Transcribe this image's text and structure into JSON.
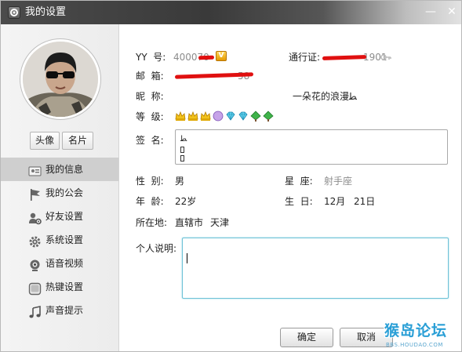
{
  "window": {
    "title": "我的设置",
    "minimize_glyph": "—",
    "close_glyph": "✕"
  },
  "sidebar": {
    "tab_avatar": "头像",
    "tab_card": "名片",
    "items": [
      {
        "label": "我的信息",
        "icon": "profile-card-icon",
        "active": true
      },
      {
        "label": "我的公会",
        "icon": "flag-icon",
        "active": false
      },
      {
        "label": "好友设置",
        "icon": "friend-gear-icon",
        "active": false
      },
      {
        "label": "系统设置",
        "icon": "gear-icon",
        "active": false
      },
      {
        "label": "语音视频",
        "icon": "webcam-icon",
        "active": false
      },
      {
        "label": "热键设置",
        "icon": "hotkey-icon",
        "active": false
      },
      {
        "label": "声音提示",
        "icon": "music-note-icon",
        "active": false
      }
    ]
  },
  "profile": {
    "yy_label": "YY  号:",
    "yy_value": "400070",
    "vip_badge": "V",
    "passport_label": "通行证:",
    "passport_value": "1901",
    "email_label": "邮  箱:",
    "email_value": "58",
    "nickname_label": "昵  称:",
    "nickname_value": "一朵花的浪漫ﻄ",
    "level_label": "等  级:",
    "level_icons": [
      "crown-icon",
      "crown-icon",
      "crown-icon",
      "moon-icon",
      "diamond-icon",
      "diamond-icon",
      "tree-icon",
      "tree-icon"
    ],
    "signature_label": "签  名:",
    "signature_lines": [
      "ﻄ"
    ],
    "gender_label": "性  别:",
    "gender_value": "男",
    "zodiac_label": "星  座:",
    "zodiac_value": "射手座",
    "age_label": "年  龄:",
    "age_value": "22岁",
    "birthday_label": "生  日:",
    "birthday_month": "12月",
    "birthday_day": "21日",
    "location_label": "所在地:",
    "location_province": "直辖市",
    "location_city": "天津",
    "description_label": "个人说明:",
    "description_value": ""
  },
  "buttons": {
    "ok": "确定",
    "cancel": "取消"
  },
  "watermark": {
    "title": "猴岛论坛",
    "subtitle": "BBS.HOUDAO.COM"
  },
  "colors": {
    "titlebar": "#3a3a3a",
    "active_menu": "#cfcfcf",
    "redaction": "#e01010",
    "focus_border": "#6dc1d6",
    "watermark": "#2a9fd6"
  }
}
